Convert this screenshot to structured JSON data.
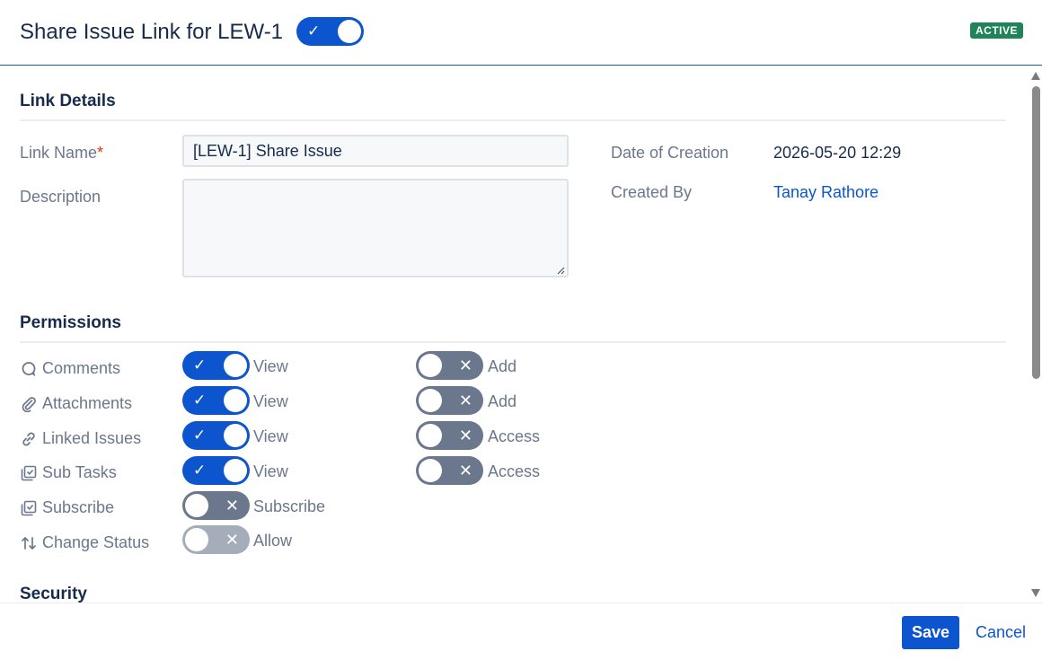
{
  "header": {
    "title": "Share Issue Link for LEW-1",
    "status_badge": "ACTIVE",
    "enabled": true
  },
  "link_details": {
    "section_title": "Link Details",
    "link_name_label": "Link Name",
    "required_mark": "*",
    "link_name_value": "[LEW-1] Share Issue",
    "description_label": "Description",
    "description_value": "",
    "date_label": "Date of Creation",
    "date_value": "2026-05-20 12:29",
    "created_by_label": "Created By",
    "created_by_value": "Tanay Rathore"
  },
  "permissions": {
    "section_title": "Permissions",
    "rows": [
      {
        "label": "Comments",
        "icon": "comment-icon",
        "primary": {
          "on": true,
          "text": "View"
        },
        "secondary": {
          "on": false,
          "text": "Add"
        }
      },
      {
        "label": "Attachments",
        "icon": "paperclip-icon",
        "primary": {
          "on": true,
          "text": "View"
        },
        "secondary": {
          "on": false,
          "text": "Add"
        }
      },
      {
        "label": "Linked Issues",
        "icon": "link-icon",
        "primary": {
          "on": true,
          "text": "View"
        },
        "secondary": {
          "on": false,
          "text": "Access"
        }
      },
      {
        "label": "Sub Tasks",
        "icon": "subtask-icon",
        "primary": {
          "on": true,
          "text": "View"
        },
        "secondary": {
          "on": false,
          "text": "Access"
        }
      },
      {
        "label": "Subscribe",
        "icon": "subscribe-icon",
        "primary": {
          "on": false,
          "text": "Subscribe"
        }
      },
      {
        "label": "Change Status",
        "icon": "change-status-icon",
        "primary": {
          "on": false,
          "disabled": true,
          "text": "Allow"
        }
      }
    ]
  },
  "security": {
    "section_title": "Security"
  },
  "footer": {
    "save_label": "Save",
    "cancel_label": "Cancel"
  },
  "colors": {
    "accent": "#0c55cf",
    "badge": "#1f845a",
    "toggle_off": "#6b778c",
    "toggle_disabled": "#a5adba"
  }
}
